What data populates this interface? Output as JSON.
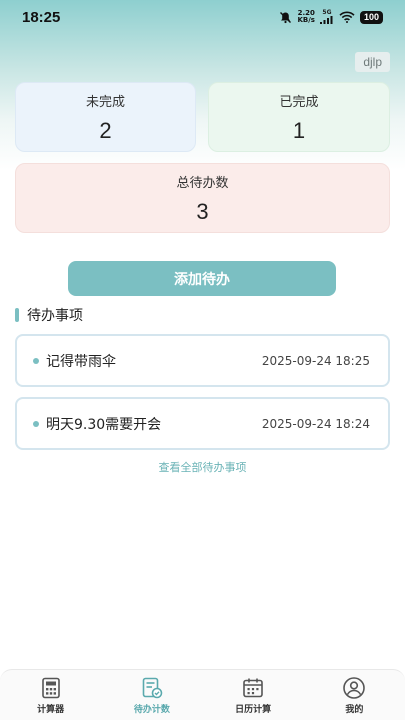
{
  "status_bar": {
    "time": "18:25",
    "net_speed_value": "2.20",
    "net_speed_unit": "KB/s",
    "network": "5G",
    "battery": "100"
  },
  "user_tag": "djlp",
  "stats": {
    "pending_label": "未完成",
    "pending_value": "2",
    "done_label": "已完成",
    "done_value": "1",
    "total_label": "总待办数",
    "total_value": "3"
  },
  "add_button_label": "添加待办",
  "section_title": "待办事项",
  "todos": [
    {
      "text": "记得带雨伞",
      "time": "2025-09-24 18:25"
    },
    {
      "text": "明天9.30需要开会",
      "time": "2025-09-24 18:24"
    }
  ],
  "view_all_label": "查看全部待办事项",
  "tabs": [
    {
      "label": "计算器",
      "icon": "calculator-icon",
      "active": false
    },
    {
      "label": "待办计数",
      "icon": "todo-icon",
      "active": true
    },
    {
      "label": "日历计算",
      "icon": "calendar-icon",
      "active": false
    },
    {
      "label": "我的",
      "icon": "profile-icon",
      "active": false
    }
  ],
  "colors": {
    "accent": "#7bbfc2",
    "pending_bg": "#ebf3fb",
    "done_bg": "#ebf7ef",
    "total_bg": "#fbecea"
  }
}
